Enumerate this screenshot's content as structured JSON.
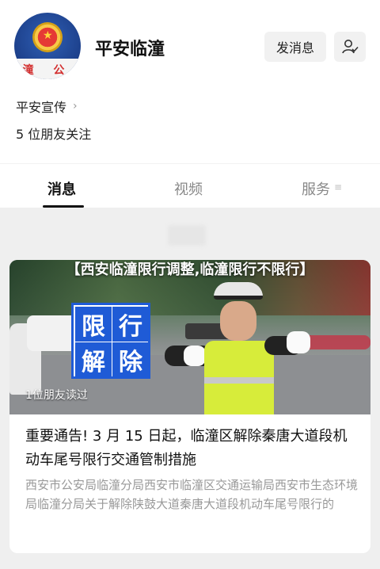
{
  "header": {
    "avatar_badge_text": "潼 公",
    "account_name": "平安临潼",
    "message_button": "发消息",
    "follow_icon": "user-check-icon",
    "sub_link": "平安宣传",
    "friends_follow": "5 位朋友关注"
  },
  "tabs": [
    {
      "label": "消息",
      "active": true
    },
    {
      "label": "视频",
      "active": false
    },
    {
      "label": "服务",
      "active": false
    }
  ],
  "article": {
    "image_title": "【西安临潼限行调整,临潼限行不限行】",
    "sign_chars": [
      "限",
      "行",
      "解",
      "除"
    ],
    "read_count": "1位朋友读过",
    "headline": "重要通告! 3 月 15 日起，临潼区解除秦唐大道段机动车尾号限行交通管制措施",
    "summary": "西安市公安局临潼分局西安市临潼区交通运输局西安市生态环境局临潼分局关于解除陕鼓大道秦唐大道段机动车尾号限行的"
  },
  "colors": {
    "sign_blue": "#1f5bd6",
    "vest_yellow": "#d7ec3a",
    "badge_red": "#d32f2f"
  }
}
